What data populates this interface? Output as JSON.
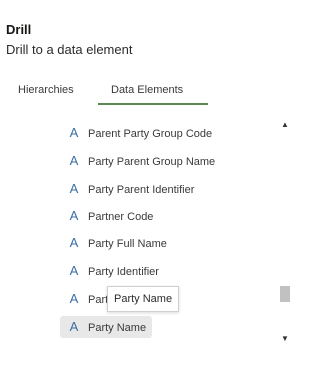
{
  "panel": {
    "title": "Drill",
    "subtitle": "Drill to a data element"
  },
  "tabs": [
    {
      "label": "Hierarchies",
      "active": false
    },
    {
      "label": "Data Elements",
      "active": true
    }
  ],
  "icons": {
    "attribute": "attribute-A-icon",
    "scroll_up": "triangle-up-icon",
    "scroll_down": "triangle-down-icon"
  },
  "items": [
    {
      "label": "Parent Party Group Code"
    },
    {
      "label": "Party Parent Group Name"
    },
    {
      "label": "Party Parent Identifier"
    },
    {
      "label": "Partner Code"
    },
    {
      "label": "Party Full Name"
    },
    {
      "label": "Party Identifier"
    },
    {
      "label": "Party Legal Name"
    },
    {
      "label": "Party Name",
      "selected": true
    }
  ],
  "tooltip": {
    "text": "Party Name"
  },
  "colors": {
    "accent_underline": "#5a8a4f",
    "icon": "#3a6ea5",
    "selected_bg": "#e8e8e8"
  }
}
